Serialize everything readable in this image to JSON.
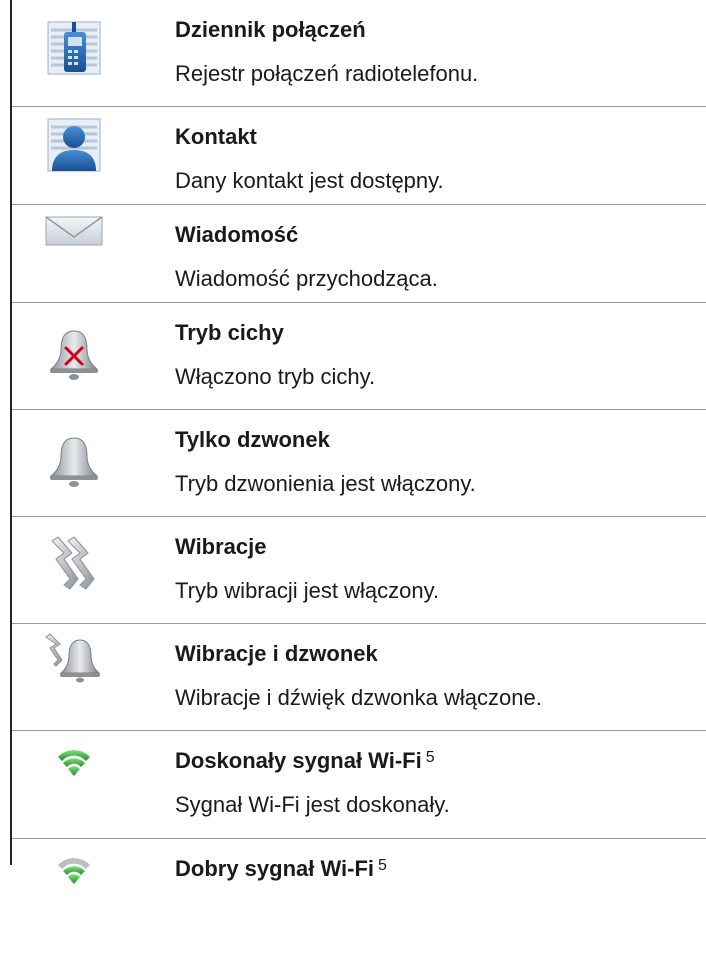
{
  "rows": [
    {
      "icon": "call-log-icon",
      "title": "Dziennik połączeń",
      "desc": "Rejestr połączeń radiotelefonu."
    },
    {
      "icon": "contact-icon",
      "title": "Kontakt",
      "desc": "Dany kontakt jest dostępny."
    },
    {
      "icon": "envelope-icon",
      "title": "Wiadomość",
      "desc": "Wiadomość przychodząca."
    },
    {
      "icon": "bell-muted-icon",
      "title": "Tryb cichy",
      "desc": "Włączono tryb cichy."
    },
    {
      "icon": "bell-icon",
      "title": "Tylko dzwonek",
      "desc": "Tryb dzwonienia jest włączony."
    },
    {
      "icon": "vibrate-icon",
      "title": "Wibracje",
      "desc": "Tryb wibracji jest włączony."
    },
    {
      "icon": "vibrate-bell-icon",
      "title": "Wibracje i dzwonek",
      "desc": "Wibracje i dźwięk dzwonka włączone."
    },
    {
      "icon": "wifi-excellent-icon",
      "title": "Doskonały sygnał Wi-Fi",
      "footnote": "5",
      "desc": "Sygnał Wi-Fi jest doskonały."
    },
    {
      "icon": "wifi-good-icon",
      "title": "Dobry sygnał Wi-Fi",
      "footnote": "5",
      "desc": ""
    }
  ]
}
